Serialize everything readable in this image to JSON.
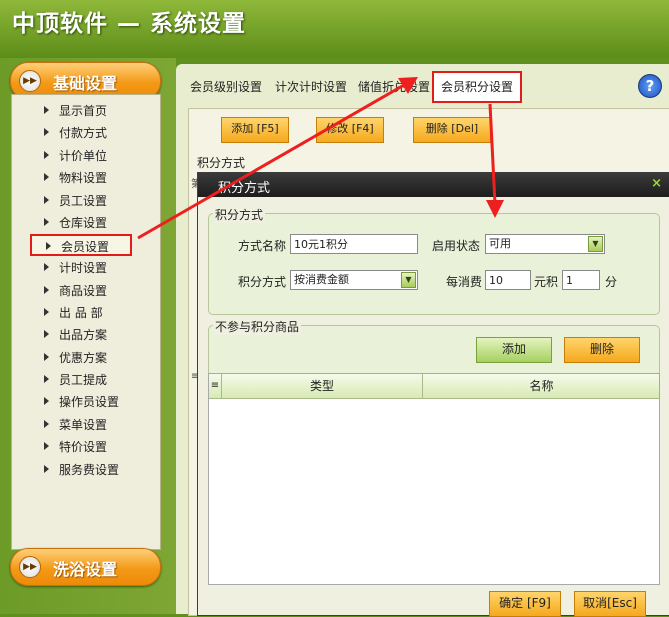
{
  "app": {
    "title": "中顶软件 — 系统设置"
  },
  "sidebar": {
    "section_top": "基础设置",
    "section_bottom": "洗浴设置",
    "items": [
      {
        "label": "显示首页"
      },
      {
        "label": "付款方式"
      },
      {
        "label": "计价单位"
      },
      {
        "label": "物料设置"
      },
      {
        "label": "员工设置"
      },
      {
        "label": "仓库设置"
      },
      {
        "label": "会员设置",
        "active": true
      },
      {
        "label": "计时设置"
      },
      {
        "label": "商品设置"
      },
      {
        "label": "出 品 部"
      },
      {
        "label": "出品方案"
      },
      {
        "label": "优惠方案"
      },
      {
        "label": "员工提成"
      },
      {
        "label": "操作员设置"
      },
      {
        "label": "菜单设置"
      },
      {
        "label": "特价设置"
      },
      {
        "label": "服务费设置"
      }
    ]
  },
  "tabs": [
    {
      "label": "会员级别设置"
    },
    {
      "label": "计次计时设置"
    },
    {
      "label": "储值折兑设置"
    },
    {
      "label": "会员积分设置",
      "selected": true
    }
  ],
  "toolbar": {
    "add": "添加 [F5]",
    "edit": "修改 [F4]",
    "delete": "删除 [Del]"
  },
  "main": {
    "group_label": "积分方式",
    "side_frag_1": "第",
    "side_frag_2": "≡"
  },
  "dialog": {
    "title": "积分方式",
    "group1_legend": "积分方式",
    "name_label": "方式名称",
    "name_value": "10元1积分",
    "status_label": "启用状态",
    "status_value": "可用",
    "mode_label": "积分方式",
    "mode_value": "按消费金额",
    "per_label": "每消费",
    "per_value": "10",
    "yuan_label": "元积",
    "points_value": "1",
    "fen_label": "分",
    "group2_legend": "不参与积分商品",
    "add_btn": "添加",
    "del_btn": "删除",
    "grid_cols": [
      "类型",
      "名称"
    ],
    "grid_corner": "≡",
    "ok_btn": "确定 [F9]",
    "cancel_btn": "取消[Esc]"
  },
  "colors": {
    "accent": "#f39a17",
    "highlight": "#e21b1b",
    "bg": "#5f8f1d"
  }
}
